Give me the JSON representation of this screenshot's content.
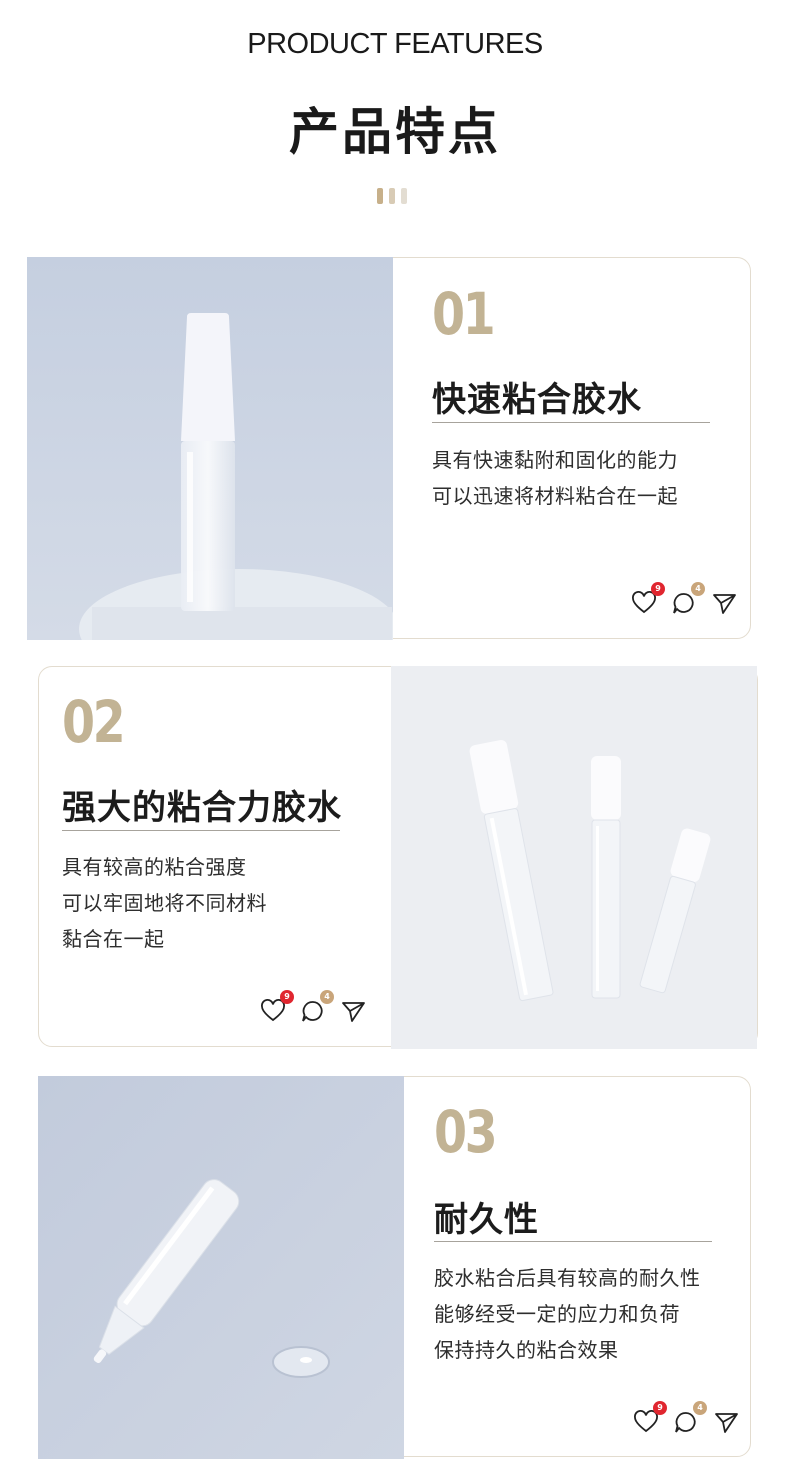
{
  "header": {
    "title_en": "PRODUCT FEATURES",
    "title_cn": "产品特点",
    "dot_colors": [
      "#c7b08a",
      "#d8cbb5",
      "#e3ddd2"
    ]
  },
  "colors": {
    "accent": "#c2b394",
    "card_border": "#e3dccf",
    "like_badge": "#e0262f",
    "comment_badge": "#c9a57a"
  },
  "features": [
    {
      "number": "01",
      "title": "快速粘合胶水",
      "lines": [
        "具有快速黏附和固化的能力",
        "可以迅速将材料粘合在一起"
      ],
      "photo": "single-glue-tube-with-white-cap",
      "likes": "9",
      "comments": "4"
    },
    {
      "number": "02",
      "title": "强大的粘合力胶水",
      "lines": [
        "具有较高的粘合强度",
        "可以牢固地将不同材料",
        "黏合在一起"
      ],
      "photo": "three-glue-tubes-different-sizes",
      "likes": "9",
      "comments": "4"
    },
    {
      "number": "03",
      "title": "耐久性",
      "lines": [
        "胶水粘合后具有较高的耐久性",
        "能够经受一定的应力和负荷",
        "保持持久的粘合效果"
      ],
      "photo": "glue-tube-dispensing-droplet",
      "likes": "9",
      "comments": "4"
    }
  ],
  "icons": {
    "like": "heart-icon",
    "comment": "comment-bubble-icon",
    "share": "send-paper-plane-icon"
  }
}
